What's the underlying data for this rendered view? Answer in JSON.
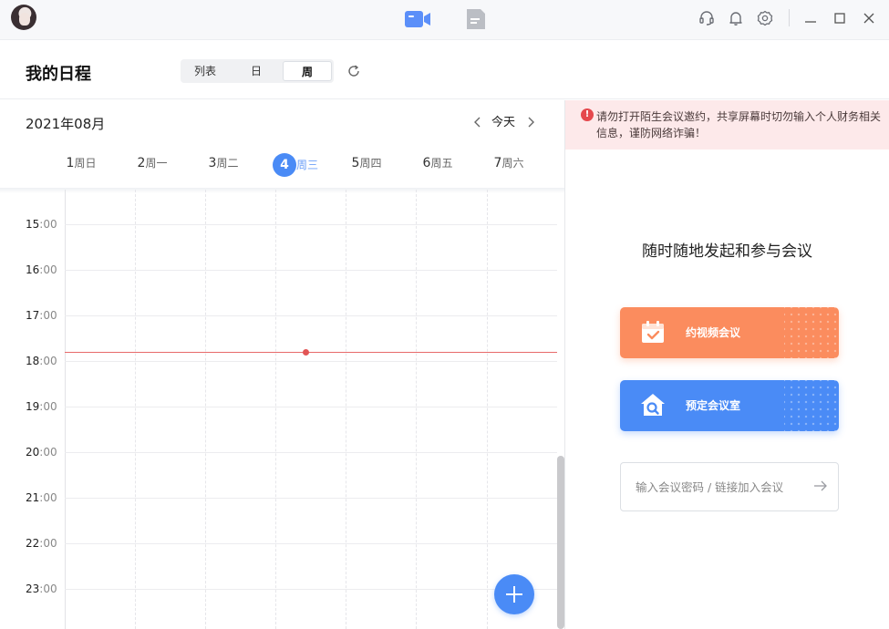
{
  "titlebar": {
    "tabs": [
      {
        "icon": "video-camera-icon",
        "color": "#5b8ff9"
      },
      {
        "icon": "document-icon",
        "color": "#bbbec4"
      }
    ],
    "actions": [
      "headset-icon",
      "bell-icon",
      "gear-icon"
    ],
    "window_controls": [
      "minimize-icon",
      "maximize-icon",
      "close-icon"
    ]
  },
  "header": {
    "title": "我的日程",
    "view_tabs": [
      {
        "label": "列表",
        "active": false
      },
      {
        "label": "日",
        "active": false
      },
      {
        "label": "周",
        "active": true
      }
    ]
  },
  "calendar": {
    "month": "2021年08月",
    "today_label": "今天",
    "days": [
      {
        "num": "1",
        "weekday": "周日",
        "selected": false
      },
      {
        "num": "2",
        "weekday": "周一",
        "selected": false
      },
      {
        "num": "3",
        "weekday": "周二",
        "selected": false
      },
      {
        "num": "4",
        "weekday": "周三",
        "selected": true
      },
      {
        "num": "5",
        "weekday": "周四",
        "selected": false
      },
      {
        "num": "6",
        "weekday": "周五",
        "selected": false
      },
      {
        "num": "7",
        "weekday": "周六",
        "selected": false
      }
    ],
    "hours": [
      {
        "h": "15",
        "m": ":00"
      },
      {
        "h": "16",
        "m": ":00"
      },
      {
        "h": "17",
        "m": ":00"
      },
      {
        "h": "18",
        "m": ":00"
      },
      {
        "h": "19",
        "m": ":00"
      },
      {
        "h": "20",
        "m": ":00"
      },
      {
        "h": "21",
        "m": ":00"
      },
      {
        "h": "22",
        "m": ":00"
      },
      {
        "h": "23",
        "m": ":00"
      }
    ],
    "accent": "#4a8bf6",
    "now_line_color": "#e86a6a"
  },
  "right_panel": {
    "warning": "请勿打开陌生会议邀约，共享屏幕时切勿输入个人财务相关信息，谨防网络诈骗！",
    "slogan": "随时随地发起和参与会议",
    "schedule_meeting": {
      "label": "约视频会议",
      "color": "#fb8c5e",
      "icon": "calendar-check-icon"
    },
    "book_room": {
      "label": "预定会议室",
      "color": "#4a8bf6",
      "icon": "room-search-icon"
    },
    "join_placeholder": "输入会议密码 / 链接加入会议"
  }
}
